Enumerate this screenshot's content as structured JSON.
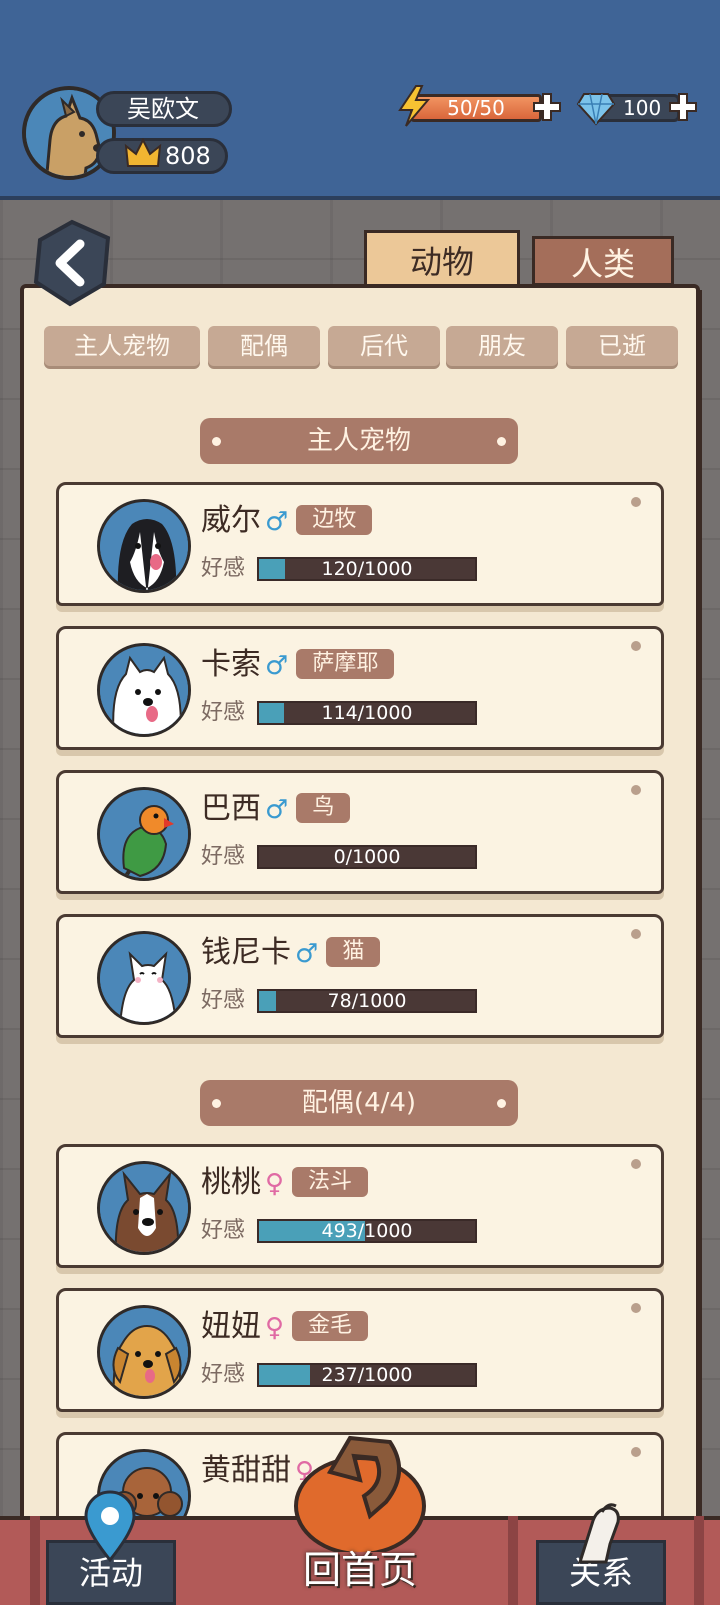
{
  "player": {
    "name": "吴欧文",
    "coins": "808",
    "energy": "50/50",
    "gems": "100"
  },
  "category_tabs": {
    "animals": "动物",
    "humans": "人类"
  },
  "filters": [
    "主人宠物",
    "配偶",
    "后代",
    "朋友",
    "已逝"
  ],
  "sections": {
    "owner_pets": "主人宠物",
    "spouses": "配偶(4/4)"
  },
  "affection_label": "好感",
  "pets": [
    {
      "name": "威尔",
      "gender": "♂",
      "breed": "边牧",
      "affection": "120/1000",
      "ratio": 0.12
    },
    {
      "name": "卡索",
      "gender": "♂",
      "breed": "萨摩耶",
      "affection": "114/1000",
      "ratio": 0.114
    },
    {
      "name": "巴西",
      "gender": "♂",
      "breed": "鸟",
      "affection": "0/1000",
      "ratio": 0
    },
    {
      "name": "钱尼卡",
      "gender": "♂",
      "breed": "猫",
      "affection": "78/1000",
      "ratio": 0.078
    }
  ],
  "spouses": [
    {
      "name": "桃桃",
      "gender": "♀",
      "breed": "法斗",
      "affection": "493/1000",
      "ratio": 0.493
    },
    {
      "name": "妞妞",
      "gender": "♀",
      "breed": "金毛",
      "affection": "237/1000",
      "ratio": 0.237
    },
    {
      "name": "黄甜甜",
      "gender": "♀"
    }
  ],
  "nav": {
    "activity": "活动",
    "home": "回首页",
    "relations": "关系"
  },
  "colors": {
    "topbar": "#3f6496",
    "parchment": "#f4e8d2",
    "accent_brown": "#a97a69",
    "affection_fill": "#4aa0b8"
  }
}
